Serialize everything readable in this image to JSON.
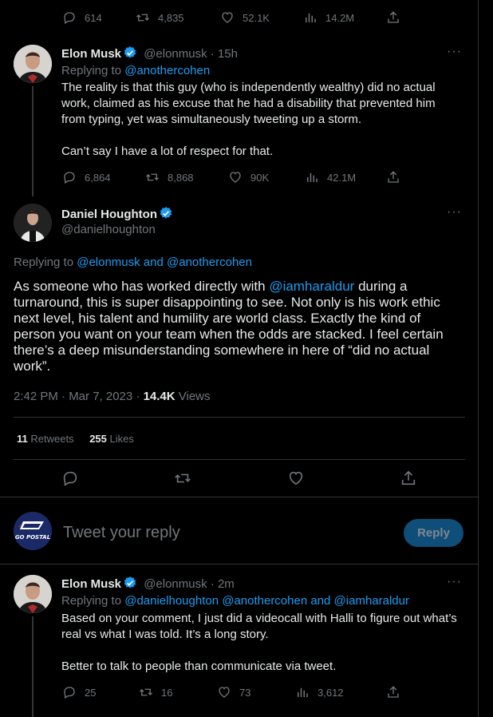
{
  "top_tweet": {
    "replies": "614",
    "retweets": "4,835",
    "likes": "52.1K",
    "views": "14.2M"
  },
  "musk_reply1": {
    "name": "Elon Musk",
    "handle": "@elonmusk",
    "time": "· 15h",
    "replying_prefix": "Replying to ",
    "replying_to": "@anothercohen",
    "text1": "The reality is that this guy (who is independently wealthy) did no actual work, claimed as his excuse that he had a disability that prevented him from typing, yet was simultaneously tweeting up a storm.",
    "text2": "Can’t say I have a lot of respect for that.",
    "replies": "6,864",
    "retweets": "8,868",
    "likes": "90K",
    "views": "42.1M"
  },
  "main_tweet": {
    "name": "Daniel Houghton",
    "handle": "@danielhoughton",
    "replying_prefix": "Replying to ",
    "replying_to": "@elonmusk and @anothercohen",
    "text_pre": "As someone who has worked directly with ",
    "mention": "@iamharaldur",
    "text_post": " during a turnaround, this is super disappointing to see. Not only is his work ethic next level, his talent and humility are world class. Exactly the kind of person you want on your team when the odds are stacked. I feel certain there’s a deep misunderstanding somewhere in here of “did no actual work”.",
    "timestamp": "2:42 PM · Mar 7, 2023 · ",
    "views_count": "14.4K",
    "views_label": " Views",
    "retweets_count": "11",
    "retweets_label": " Retweets",
    "likes_count": "255",
    "likes_label": " Likes"
  },
  "reply_box": {
    "avatar_text": "GO POSTAL",
    "placeholder": "Tweet your reply",
    "button": "Reply"
  },
  "musk_reply2": {
    "name": "Elon Musk",
    "handle": "@elonmusk",
    "time": "· 2m",
    "replying_prefix": "Replying to ",
    "replying_to": "@danielhoughton @anothercohen and @iamharaldur",
    "text1": "Based on your comment, I just did a videocall with Halli to figure out what’s real vs what I was told. It’s a long story.",
    "text2": "Better to talk to people than communicate via tweet.",
    "replies": "25",
    "retweets": "16",
    "likes": "73",
    "views": "3,612"
  },
  "colors": {
    "accent": "#1d9bf0",
    "muted": "#71767b",
    "reply_button": "#0f4e78"
  }
}
